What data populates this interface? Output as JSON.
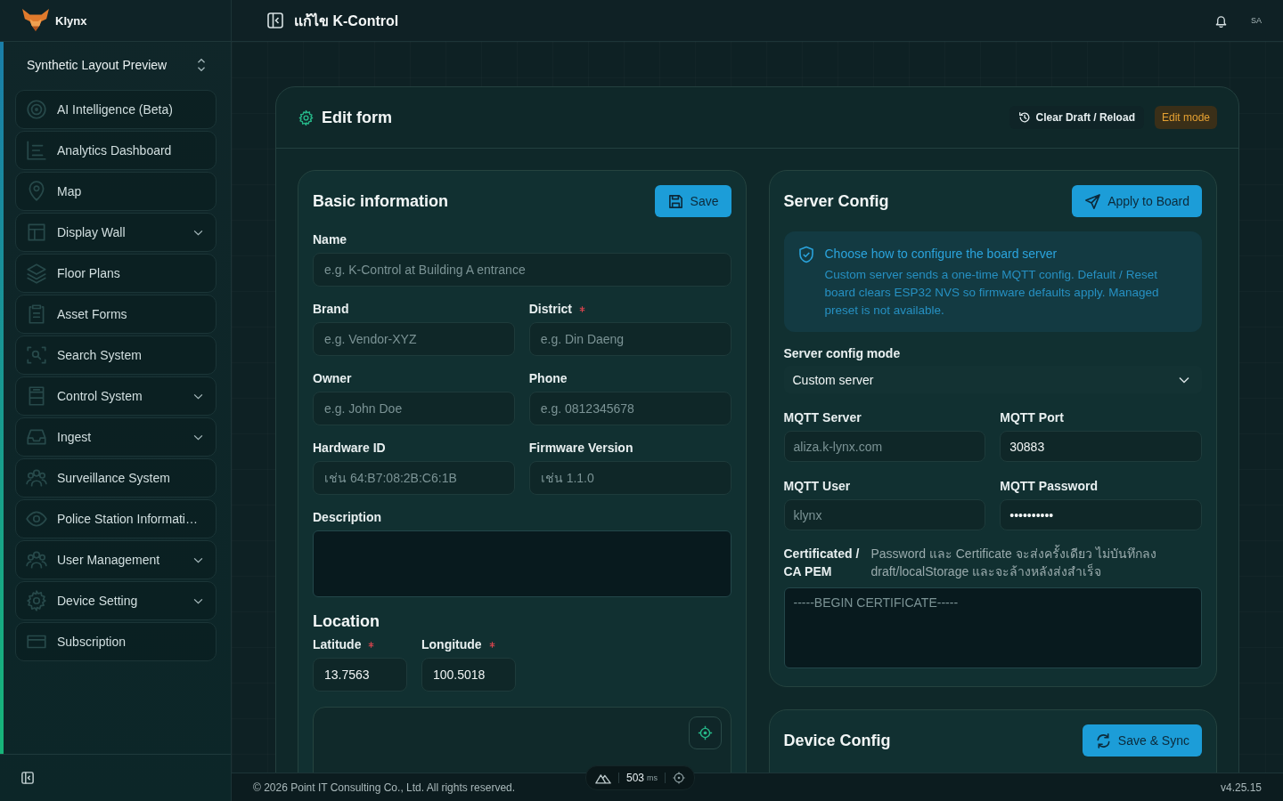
{
  "sidebar": {
    "brand": "Klynx",
    "workspace": "Synthetic Layout Preview",
    "items": [
      {
        "label": "AI Intelligence (Beta)",
        "kind": "link",
        "selected": false
      },
      {
        "label": "Analytics Dashboard",
        "kind": "link",
        "selected": false
      },
      {
        "label": "Map",
        "kind": "link",
        "selected": false
      },
      {
        "label": "Display Wall",
        "kind": "group",
        "selected": false
      },
      {
        "label": "Floor Plans",
        "kind": "link",
        "selected": false
      },
      {
        "label": "Asset Forms",
        "kind": "link",
        "selected": false
      },
      {
        "label": "Search System",
        "kind": "link",
        "selected": false
      },
      {
        "label": "Control System",
        "kind": "group",
        "selected": false
      },
      {
        "label": "Ingest",
        "kind": "group",
        "selected": false
      },
      {
        "label": "Surveillance System",
        "kind": "link",
        "selected": false
      },
      {
        "label": "Police Station Informati…",
        "kind": "link",
        "selected": false
      },
      {
        "label": "User Management",
        "kind": "group",
        "selected": false
      },
      {
        "label": "Device Setting",
        "kind": "group",
        "selected": false
      },
      {
        "label": "Subscription",
        "kind": "link",
        "selected": false
      }
    ]
  },
  "topbar": {
    "title": "แก้ไข K-Control",
    "avatar": "SA"
  },
  "edit_form": {
    "title": "Edit form",
    "clear_button": "Clear Draft / Reload",
    "mode_badge": "Edit mode",
    "basic_information": {
      "title": "Basic information",
      "save_button": "Save",
      "rows": [
        [
          {
            "label": "Name",
            "kind": "input",
            "required": false,
            "placeholder": "e.g. K-Control at Building A entrance"
          }
        ],
        [
          {
            "label": "Brand",
            "kind": "input",
            "required": false,
            "placeholder": "e.g. Vendor-XYZ"
          },
          {
            "label": "District",
            "kind": "input",
            "required": true,
            "placeholder": "e.g. Din Daeng"
          }
        ],
        [
          {
            "label": "Owner",
            "kind": "input",
            "required": false,
            "placeholder": "e.g. John Doe"
          },
          {
            "label": "Phone",
            "kind": "input",
            "required": false,
            "placeholder": "e.g. 0812345678"
          }
        ],
        [
          {
            "label": "Hardware ID",
            "kind": "input",
            "required": false,
            "placeholder": "เช่น 64:B7:08:2B:C6:1B"
          },
          {
            "label": "Firmware Version",
            "kind": "input",
            "required": false,
            "placeholder": "เช่น 1.1.0"
          }
        ],
        [
          {
            "label": "Description",
            "kind": "textarea",
            "required": false
          }
        ]
      ],
      "location": {
        "title": "Location",
        "fields": [
          {
            "label": "Latitude",
            "kind": "input",
            "required": true,
            "value": "13.7563"
          },
          {
            "label": "Longitude",
            "kind": "input",
            "required": true,
            "value": "100.5018"
          }
        ]
      }
    },
    "server_config": {
      "title": "Server Config",
      "apply_button": "Apply to Board",
      "notice": {
        "title": "Choose how to configure the board server",
        "text": "Custom server sends a one-time MQTT config. Default / Reset board clears ESP32 NVS so firmware defaults apply. Managed preset is not available."
      },
      "mode": {
        "label": "Server config mode",
        "value": "Custom server"
      },
      "rows": [
        [
          {
            "label": "MQTT Server",
            "kind": "input",
            "required": false,
            "placeholder": "aliza.k-lynx.com"
          },
          {
            "label": "MQTT Port",
            "kind": "input",
            "required": false,
            "value": "30883"
          }
        ],
        [
          {
            "label": "MQTT User",
            "kind": "input",
            "required": false,
            "placeholder": "klynx"
          },
          {
            "label": "MQTT Password",
            "kind": "input",
            "required": false,
            "value": "••••••••••"
          }
        ]
      ],
      "certificate": {
        "label": "Certificated / CA PEM",
        "note": "Password และ Certificate จะส่งครั้งเดียว ไม่บันทึกลง draft/localStorage และจะล้างหลังส่งสำเร็จ",
        "placeholder": "-----BEGIN CERTIFICATE-----"
      }
    },
    "device_config": {
      "title": "Device Config",
      "sync_button": "Save & Sync"
    }
  },
  "footer": {
    "copyright": "© 2026 Point IT Consulting Co., Ltd. All rights reserved.",
    "version": "v4.25.15"
  },
  "latency": {
    "value": "503",
    "unit": "ms"
  }
}
